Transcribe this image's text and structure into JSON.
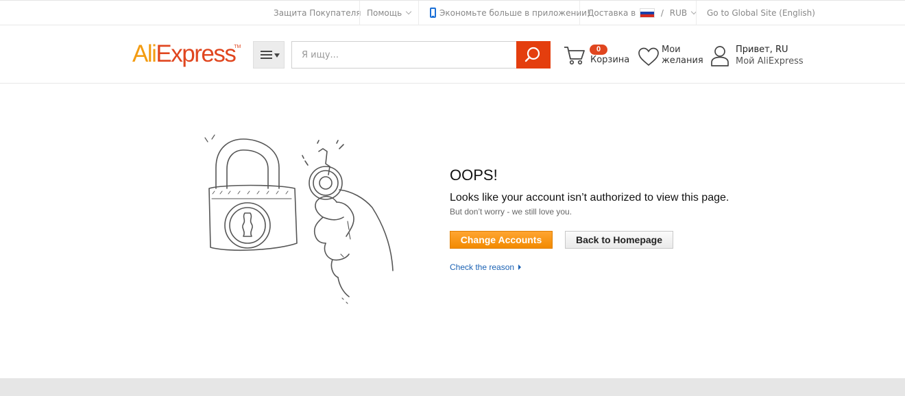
{
  "topbar": {
    "buyer_protection": "Защита Покупателя",
    "help": "Помощь",
    "app_promo": "Экономьте больше в приложении!",
    "ship_to": "Доставка в",
    "divider": "/",
    "currency": "RUB",
    "global_site": "Go to Global Site (English)"
  },
  "header": {
    "logo_ali": "Ali",
    "logo_express": "Express",
    "logo_tm": "TM",
    "search_placeholder": "Я ищу...",
    "cart_count": "0",
    "cart_label": "Корзина",
    "wishlist_line1": "Мои",
    "wishlist_line2": "желания",
    "user_hello": "Привет, RU",
    "user_account": "Мой AliExpress"
  },
  "main": {
    "title": "OOPS!",
    "message": "Looks like your account isn’t authorized to view this page.",
    "submessage": "But don’t worry - we still love you.",
    "change_accounts": "Change Accounts",
    "back_home": "Back to Homepage",
    "check_reason": "Check the reason"
  },
  "colors": {
    "brand_orange": "#f39c12",
    "brand_red": "#e0461f",
    "search_button": "#e43e0e",
    "primary_button": "#ff9a1a",
    "link": "#1b62b4"
  },
  "icons": {
    "phone": "phone-icon",
    "flag": "russia-flag-icon",
    "menu": "hamburger-menu-icon",
    "search": "search-icon",
    "cart": "cart-icon",
    "wishlist": "heart-icon",
    "user": "user-icon",
    "illustration": "padlock-and-key-illustration"
  }
}
